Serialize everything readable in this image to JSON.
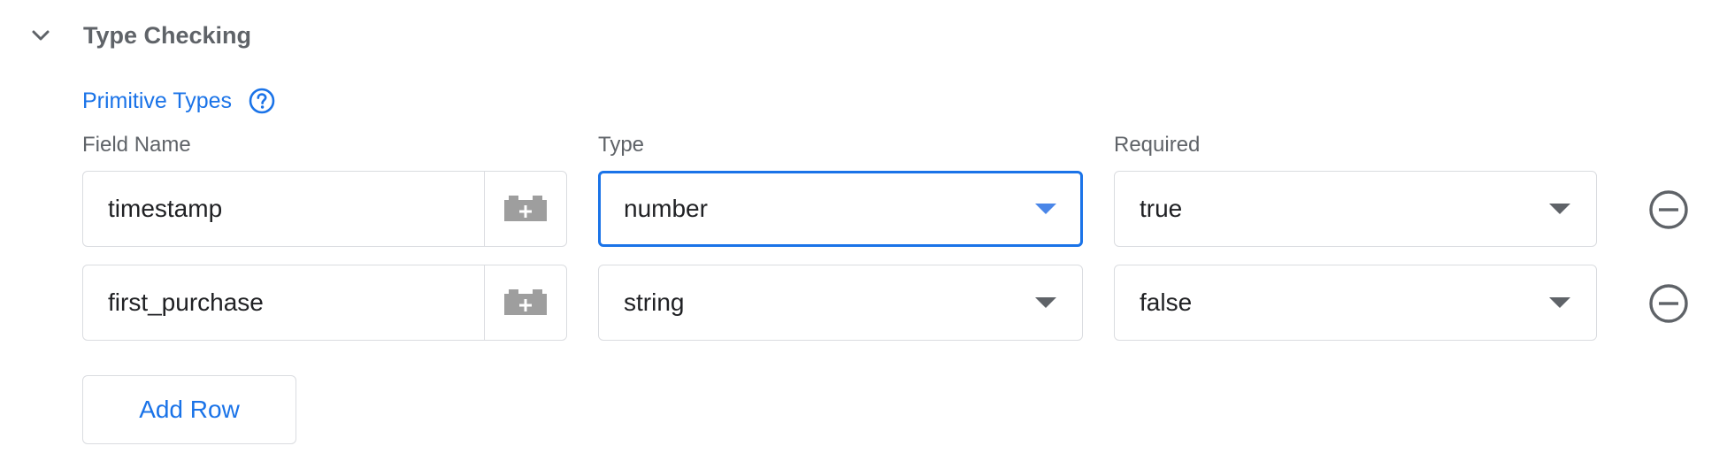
{
  "section": {
    "title": "Type Checking",
    "expand_icon": "chevron-down-icon"
  },
  "group": {
    "title": "Primitive Types",
    "help_icon": "help-circle-icon"
  },
  "columns": {
    "field_name": "Field Name",
    "type": "Type",
    "required": "Required"
  },
  "rows": [
    {
      "field_name": "timestamp",
      "type": "number",
      "required": "true",
      "type_focused": true
    },
    {
      "field_name": "first_purchase",
      "type": "string",
      "required": "false",
      "type_focused": false
    }
  ],
  "icons": {
    "variable": "variable-block-icon",
    "remove": "remove-circle-icon",
    "dropdown": "dropdown-caret-icon"
  },
  "add_row_label": "Add Row",
  "colors": {
    "accent": "#1a73e8",
    "border": "#dadce0",
    "muted_text": "#5f6368",
    "icon_gray": "#9e9e9e"
  }
}
